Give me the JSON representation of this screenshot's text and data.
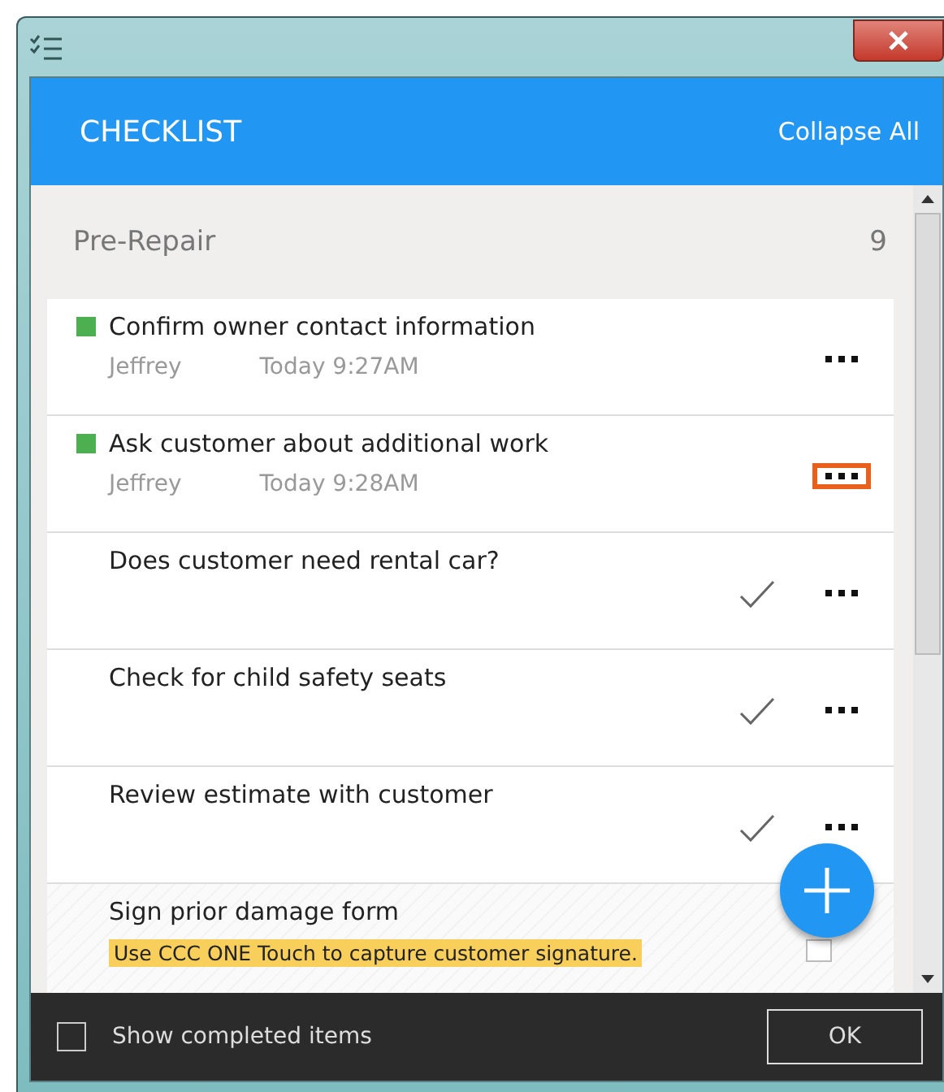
{
  "header": {
    "title": "CHECKLIST",
    "action": "Collapse All"
  },
  "section": {
    "title": "Pre-Repair",
    "count": "9"
  },
  "items": [
    {
      "kind": "started",
      "title": "Confirm owner contact information",
      "user": "Jeffrey",
      "time": "Today 9:27AM",
      "highlighted": false
    },
    {
      "kind": "started",
      "title": "Ask customer about additional work",
      "user": "Jeffrey",
      "time": "Today 9:28AM",
      "highlighted": true
    },
    {
      "kind": "open",
      "title": "Does customer need rental car?",
      "highlighted": false
    },
    {
      "kind": "open",
      "title": "Check for child safety seats",
      "highlighted": false
    },
    {
      "kind": "open",
      "title": "Review estimate with customer",
      "highlighted": false
    },
    {
      "kind": "form",
      "title": "Sign prior damage form",
      "note": "Use CCC ONE Touch to capture customer signature.",
      "checked": false
    }
  ],
  "footer": {
    "checkbox": {
      "label": "Show completed items",
      "checked": false
    },
    "button": "OK"
  }
}
